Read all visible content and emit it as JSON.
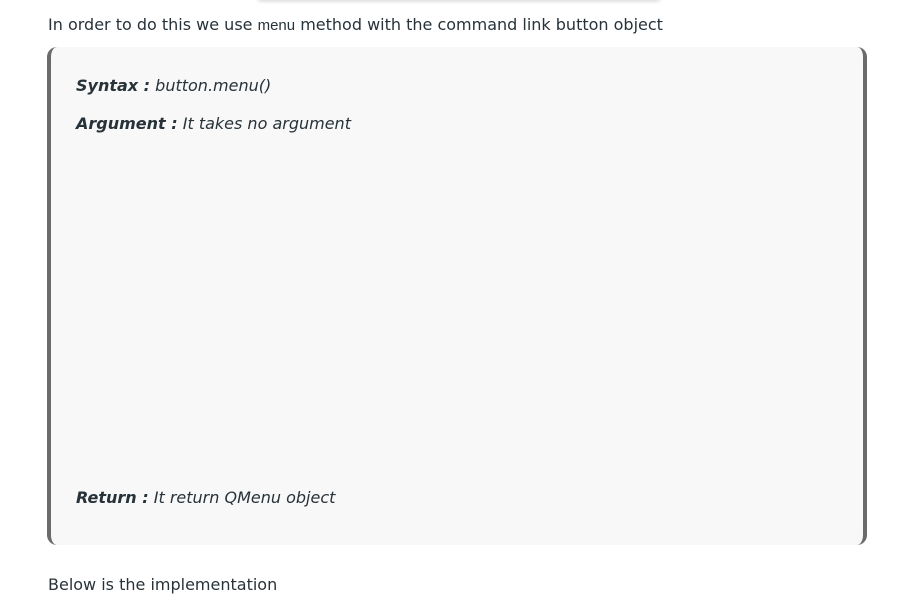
{
  "intro": {
    "before": "In order to do this we use ",
    "code": "menu",
    "after": " method with the command link button object"
  },
  "note": {
    "syntax_label": "Syntax :",
    "syntax_value": " button.menu()",
    "argument_label": "Argument :",
    "argument_value": " It takes no argument",
    "return_label": "Return :",
    "return_value": " It return QMenu object"
  },
  "outro": "Below is the implementation"
}
